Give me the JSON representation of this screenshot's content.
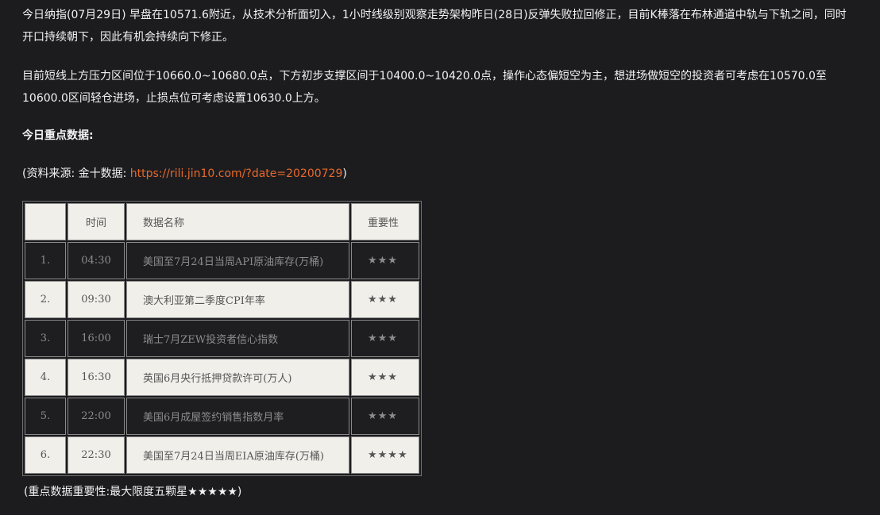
{
  "article": {
    "paragraph1": "今日纳指(07月29日) 早盘在10571.6附近，从技术分析面切入，1小时线级别观察走势架构昨日(28日)反弹失败拉回修正，目前K棒落在布林通道中轨与下轨之间，同时开口持续朝下，因此有机会持续向下修正。",
    "paragraph2": "目前短线上方压力区间位于10660.0~10680.0点，下方初步支撑区间于10400.0~10420.0点，操作心态偏短空为主，想进场做短空的投资者可考虑在10570.0至10600.0区间轻仓进场，止损点位可考虑设置10630.0上方。",
    "heading": "今日重点数据:",
    "source_prefix": "(资料来源: 金十数据: ",
    "source_link": "https://rili.jin10.com/?date=20200729",
    "source_suffix": ")",
    "footer": "(重点数据重要性:最大限度五颗星★★★★★)"
  },
  "table": {
    "headers": [
      "",
      "时间",
      "数据名称",
      "重要性"
    ],
    "rows": [
      {
        "idx": "1.",
        "time": "04:30",
        "name": "美国至7月24日当周API原油库存(万桶)",
        "importance": "★★★"
      },
      {
        "idx": "2.",
        "time": "09:30",
        "name": "澳大利亚第二季度CPI年率",
        "importance": "★★★"
      },
      {
        "idx": "3.",
        "time": "16:00",
        "name": "瑞士7月ZEW投资者信心指数",
        "importance": "★★★"
      },
      {
        "idx": "4.",
        "time": "16:30",
        "name": "英国6月央行抵押贷款许可(万人)",
        "importance": "★★★"
      },
      {
        "idx": "5.",
        "time": "22:00",
        "name": "美国6月成屋签约销售指数月率",
        "importance": "★★★"
      },
      {
        "idx": "6.",
        "time": "22:30",
        "name": "美国至7月24日当周EIA原油库存(万桶)",
        "importance": "★★★★"
      }
    ]
  },
  "colors": {
    "background": "#1c1c1f",
    "text": "#f2f2f2",
    "link": "#e8692a",
    "row_light": "#f0efea",
    "row_dark": "#1e1e21"
  }
}
